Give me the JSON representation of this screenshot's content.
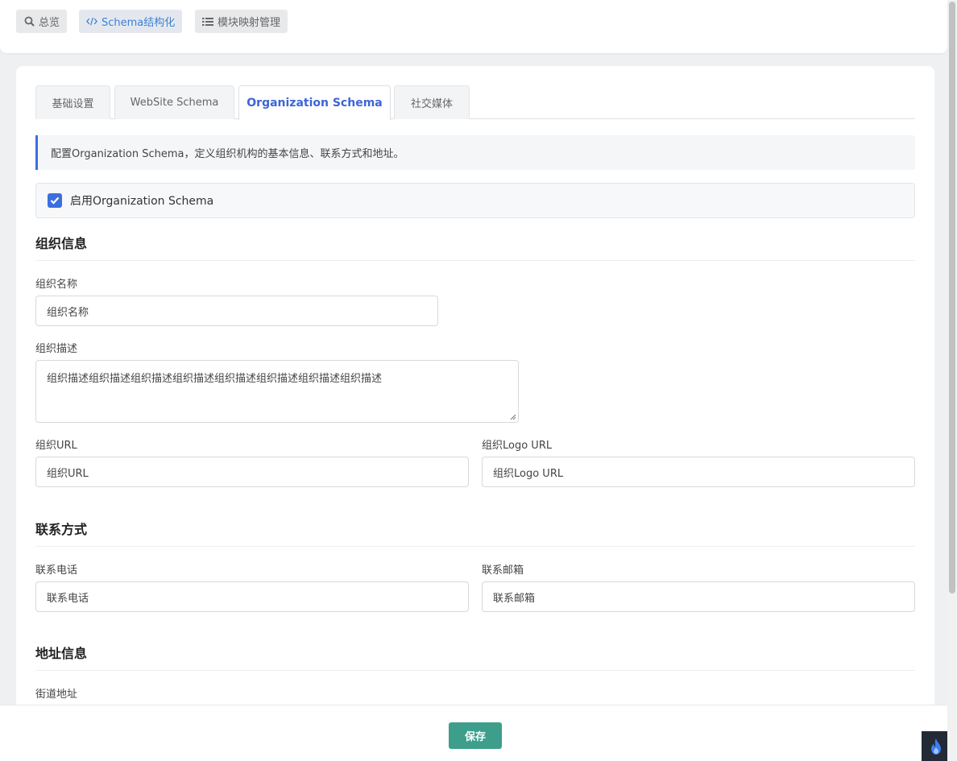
{
  "nav": {
    "items": [
      {
        "label": "总览",
        "icon": "search-icon"
      },
      {
        "label": "Schema结构化",
        "icon": "code-icon"
      },
      {
        "label": "模块映射管理",
        "icon": "list-icon"
      }
    ]
  },
  "tabs": [
    {
      "label": "基础设置"
    },
    {
      "label": "WebSite Schema"
    },
    {
      "label": "Organization Schema"
    },
    {
      "label": "社交媒体"
    }
  ],
  "info_text": "配置Organization Schema，定义组织机构的基本信息、联系方式和地址。",
  "enable": {
    "label": "启用Organization Schema",
    "checked": true
  },
  "sections": {
    "org_info": "组织信息",
    "contact": "联系方式",
    "address": "地址信息"
  },
  "fields": {
    "org_name": {
      "label": "组织名称",
      "value": "组织名称"
    },
    "org_desc": {
      "label": "组织描述",
      "value": "组织描述组织描述组织描述组织描述组织描述组织描述组织描述组织描述"
    },
    "org_url": {
      "label": "组织URL",
      "value": "组织URL"
    },
    "org_logo": {
      "label": "组织Logo URL",
      "value": "组织Logo URL"
    },
    "phone": {
      "label": "联系电话",
      "value": "联系电话"
    },
    "email": {
      "label": "联系邮箱",
      "value": "联系邮箱"
    },
    "street": {
      "label": "街道地址"
    }
  },
  "save_label": "保存",
  "colors": {
    "accent": "#3b6fe0",
    "tab_active_text": "#3f64d6",
    "save_button": "#3e9e8c"
  }
}
